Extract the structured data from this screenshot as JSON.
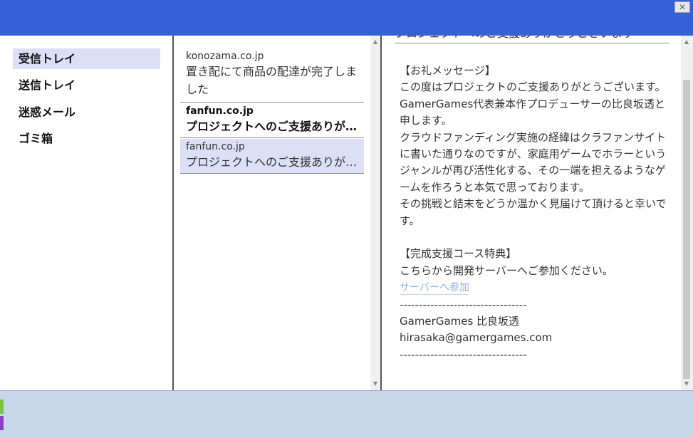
{
  "window": {
    "close_label": "✕"
  },
  "folders": [
    {
      "label": "受信トレイ",
      "active": true
    },
    {
      "label": "送信トレイ"
    },
    {
      "label": "迷惑メール"
    },
    {
      "label": "ゴミ箱"
    }
  ],
  "mails": [
    {
      "from": "konozama.co.jp",
      "subject": "置き配にて商品の配達が完了しました"
    },
    {
      "from": "fanfun.co.jp",
      "subject": "プロジェクトへのご支援ありがとうございます"
    },
    {
      "from": "fanfun.co.jp",
      "subject": "プロジェクトへのご支援ありがとうございます"
    }
  ],
  "reader": {
    "subject": "プロジェクトへのご支援ありがとうございます",
    "lines": [
      "【お礼メッセージ】",
      "この度はプロジェクトのご支援ありがとうございます。",
      "GamerGames代表兼本作プロデューサーの比良坂透と申します。",
      "クラウドファンディング実施の経緯はクラファンサイトに書いた通りなのですが、家庭用ゲームでホラーというジャンルが再び活性化する、その一端を担えるようなゲームを作ろうと本気で思っております。",
      "その挑戦と結末をどうか温かく見届けて頂けると幸いです。",
      "【完成支援コース特典】",
      "こちらから開発サーバーへご参加ください。"
    ],
    "link_label": "サーバーへ参加",
    "separator": "---------------------------------",
    "sig_name": "GamerGames 比良坂透",
    "sig_email": "hirasaka@gamergames.com"
  }
}
